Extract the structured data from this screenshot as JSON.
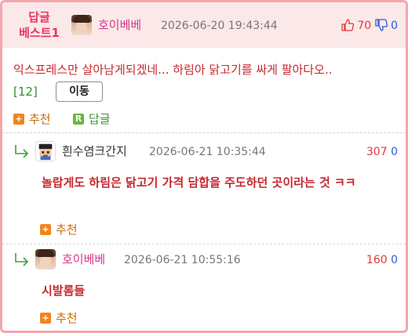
{
  "best": {
    "badge_line1": "답글",
    "badge_line2": "베스트1",
    "nickname": "호이베베",
    "date": "2026-06-20 19:43:44",
    "up_count": "70",
    "down_count": "0",
    "body": "익스프레스만 살아남게되겠네... 하림아 닭고기를 싸게 팔아다오..",
    "reply_count": "[12]",
    "move_label": "이동",
    "recommend_label": "추천",
    "reply_label": "답글",
    "reply_icon_letter": "R",
    "plus_icon": "+"
  },
  "replies": [
    {
      "nickname": "흰수염크간지",
      "date": "2026-06-21 10:35:44",
      "up_count": "307",
      "down_count": "0",
      "body": "놀랍게도 하림은 닭고기 가격 담합을 주도하던 곳이라는 것 ㅋㅋ",
      "recommend_label": "추천"
    },
    {
      "nickname": "호이베베",
      "date": "2026-06-21 10:55:16",
      "up_count": "160",
      "down_count": "0",
      "body": "시발롬들",
      "recommend_label": "추천"
    }
  ],
  "colors": {
    "border": "#f3a7ab",
    "header_bg": "#fbe8e9",
    "badge": "#e8355f",
    "nickname": "#d9378c",
    "body_text": "#c7262c",
    "vote_up": "#e03a3a",
    "vote_down": "#2a5fd0",
    "recommend": "#f1851c",
    "reply_green": "#6fb43b"
  }
}
